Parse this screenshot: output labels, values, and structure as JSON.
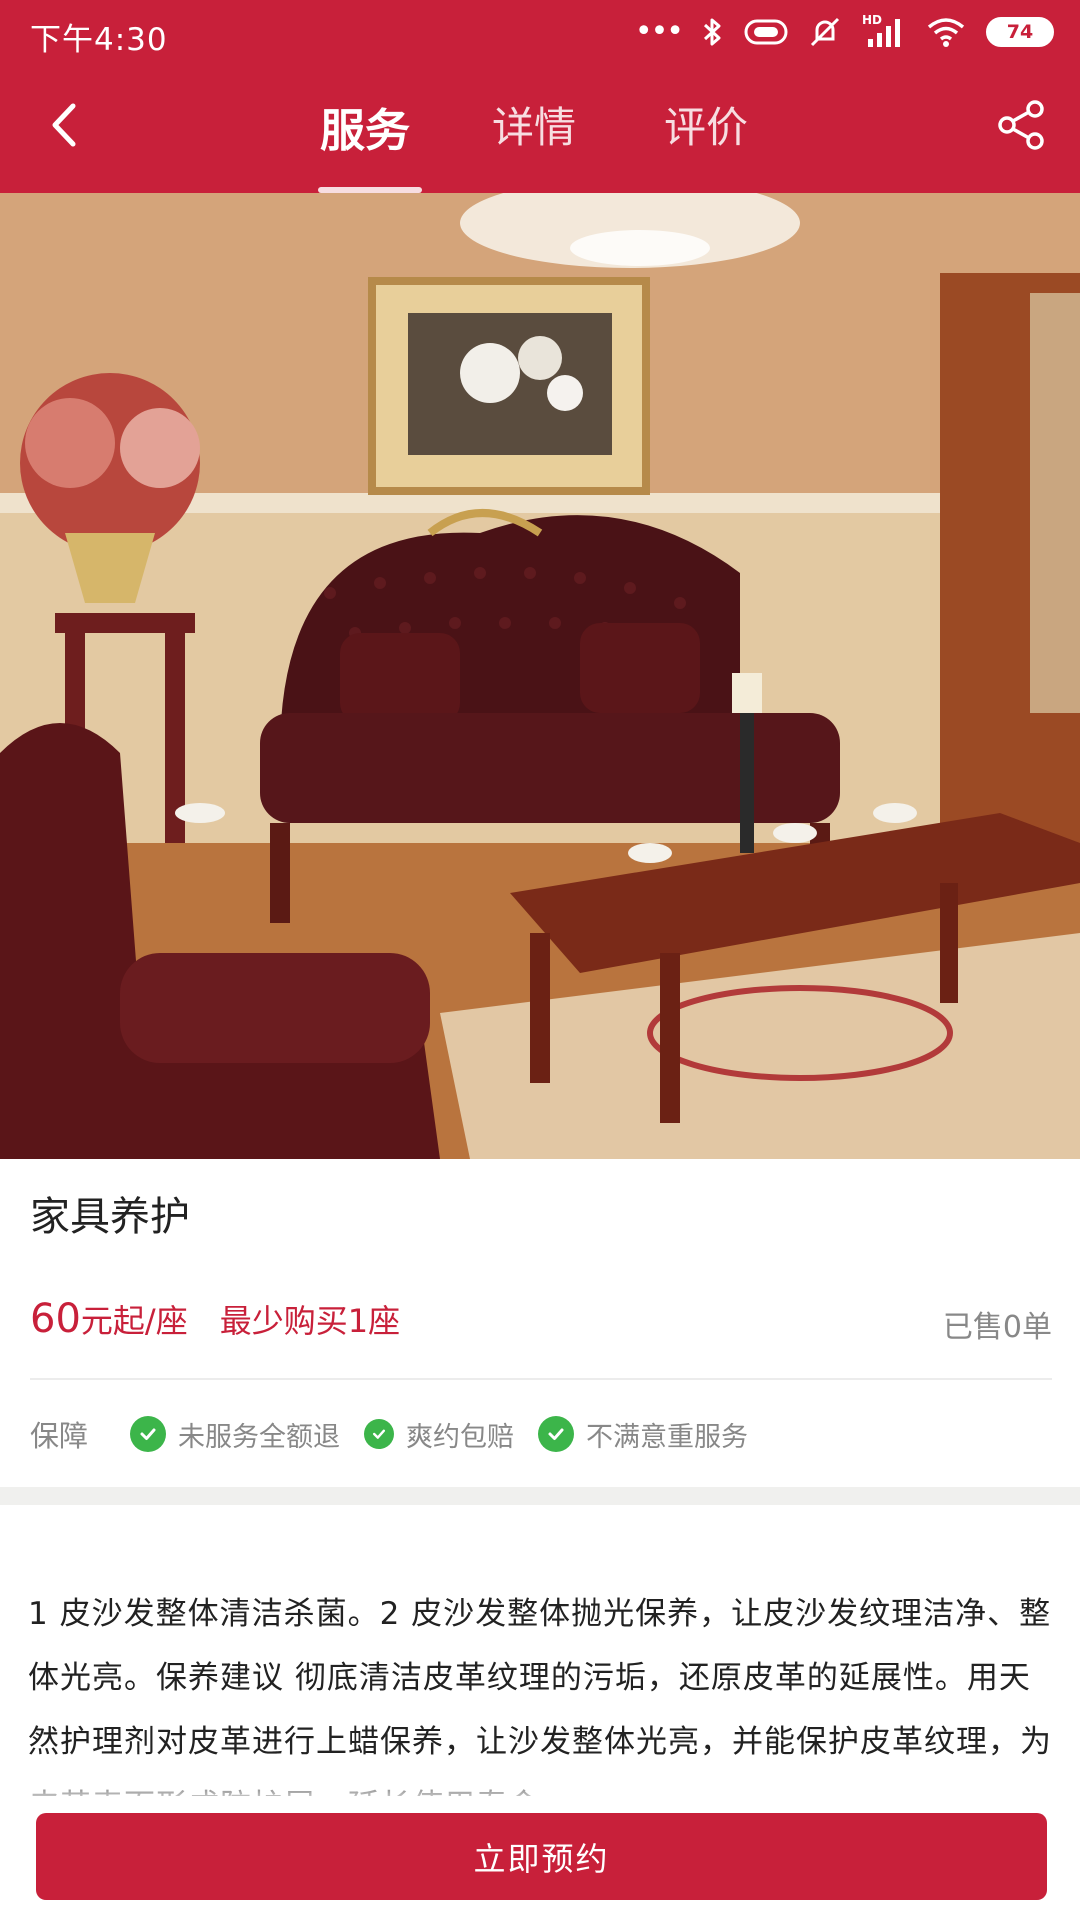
{
  "status_bar": {
    "time": "下午4:30",
    "battery": "74",
    "network_badge": "HD",
    "icons": [
      "more-dots-icon",
      "bluetooth-icon",
      "nfc-icon",
      "silent-icon",
      "signal-icon",
      "wifi-icon",
      "battery-icon"
    ]
  },
  "nav": {
    "tabs": [
      {
        "label": "服务",
        "active": true
      },
      {
        "label": "详情",
        "active": false
      },
      {
        "label": "评价",
        "active": false
      }
    ],
    "back_icon": "chevron-left-icon",
    "share_icon": "share-icon"
  },
  "hero": {
    "icon": "product-photo-living-room-sofa"
  },
  "product": {
    "title": "家具养护",
    "price_number": "60",
    "price_unit": "元起/座",
    "min_purchase": "最少购买1座",
    "sold": "已售0单"
  },
  "guarantee": {
    "label": "保障",
    "items": [
      {
        "text": "未服务全额退"
      },
      {
        "text": "爽约包赔"
      },
      {
        "text": "不满意重服务"
      }
    ]
  },
  "description": {
    "text": "1 皮沙发整体清洁杀菌。2 皮沙发整体抛光保养，让皮沙发纹理洁净、整体光亮。保养建议 彻底清洁皮革纹理的污垢，还原皮革的延展性。用天然护理剂对皮革进行上蜡保养，让沙发整体光亮，并能保护皮革纹理，为皮革表面形成防护层，延长使用寿命。"
  },
  "cta": {
    "label": "立即预约"
  },
  "colors": {
    "brand": "#c8203a",
    "check_green": "#3cb54a",
    "muted_text": "#888888"
  }
}
